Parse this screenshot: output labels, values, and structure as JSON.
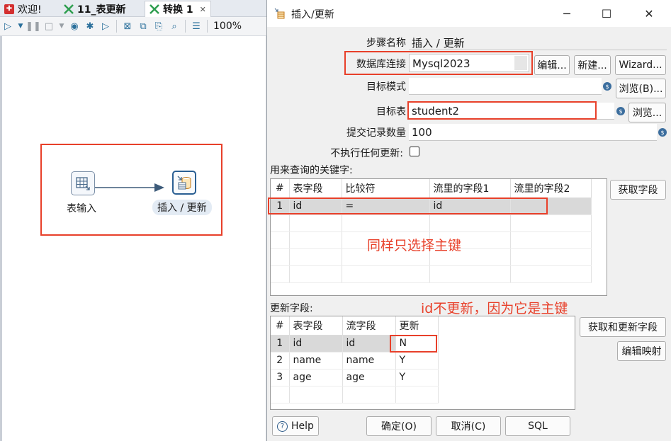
{
  "tabs": [
    {
      "label": "欢迎!",
      "icon": "welcome-icon",
      "color": "#d32f2f"
    },
    {
      "label": "11_表更新",
      "icon": "transformation-icon",
      "color": "#2e9e4f"
    },
    {
      "label": "转换 1",
      "icon": "transformation-icon",
      "color": "#2e9e4f",
      "close": "✕"
    }
  ],
  "toolbar": {
    "zoom": "100%"
  },
  "canvas": {
    "steps": [
      {
        "label": "表输入",
        "icon": "table-input-icon"
      },
      {
        "label": "插入 / 更新",
        "icon": "insert-update-icon"
      }
    ]
  },
  "dialog": {
    "title": "插入/更新",
    "step_name_label": "步骤名称",
    "step_name_value": "插入 / 更新",
    "connection_label": "数据库连接",
    "connection_value": "Mysql2023",
    "edit_btn": "编辑...",
    "new_btn": "新建...",
    "wizard_btn": "Wizard...",
    "schema_label": "目标模式",
    "schema_value": "",
    "browse_b_btn": "浏览(B)...",
    "table_label": "目标表",
    "table_value": "student2",
    "browse_btn": "浏览...",
    "commit_label": "提交记录数量",
    "commit_value": "100",
    "no_update_label": "不执行任何更新:",
    "no_update_checked": false,
    "key_section_label": "用来查询的关键字:",
    "key_columns": [
      "#",
      "表字段",
      "比较符",
      "流里的字段1",
      "流里的字段2"
    ],
    "key_rows": [
      {
        "n": "1",
        "table_field": "id",
        "comparator": "=",
        "stream1": "id",
        "stream2": ""
      }
    ],
    "get_fields_btn": "获取字段",
    "update_section_label": "更新字段:",
    "update_columns": [
      "#",
      "表字段",
      "流字段",
      "更新"
    ],
    "update_rows": [
      {
        "n": "1",
        "table_field": "id",
        "stream_field": "id",
        "update": "N"
      },
      {
        "n": "2",
        "table_field": "name",
        "stream_field": "name",
        "update": "Y"
      },
      {
        "n": "3",
        "table_field": "age",
        "stream_field": "age",
        "update": "Y"
      }
    ],
    "get_update_fields_btn": "获取和更新字段",
    "edit_mapping_btn": "编辑映射",
    "help_btn": "Help",
    "ok_btn": "确定(O)",
    "cancel_btn": "取消(C)",
    "sql_btn": "SQL"
  },
  "annotations": {
    "key_note": "同样只选择主键",
    "update_note": "id不更新，因为它是主键"
  },
  "colors": {
    "annotation": "#e8402a",
    "selected_row": "#d9d9d9",
    "link": "#2e5c8a"
  }
}
